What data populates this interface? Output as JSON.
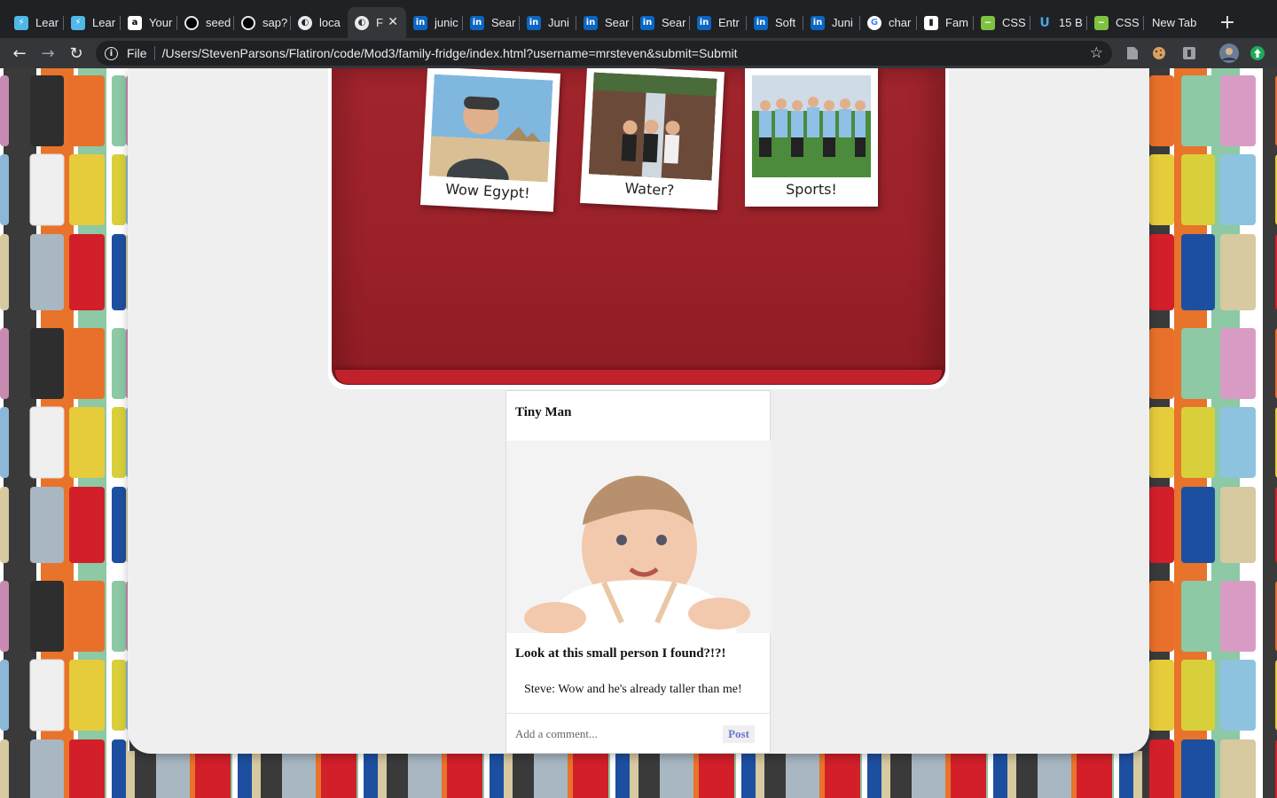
{
  "browser": {
    "tabs": [
      {
        "title": "Lear",
        "icon": "learn-icon",
        "color": "#4fb8e8"
      },
      {
        "title": "Lear",
        "icon": "learn-icon",
        "color": "#4fb8e8"
      },
      {
        "title": "Your",
        "icon": "amazon-icon",
        "color": "#ffffff"
      },
      {
        "title": "seed",
        "icon": "github-icon",
        "color": "#e8eaed"
      },
      {
        "title": "sap?",
        "icon": "github-icon",
        "color": "#e8eaed"
      },
      {
        "title": "loca",
        "icon": "globe-icon",
        "color": "#e8eaed"
      },
      {
        "title": "F",
        "icon": "globe-icon",
        "color": "#e8eaed",
        "active": true
      },
      {
        "title": "junic",
        "icon": "linkedin-icon",
        "color": "#0a66c2"
      },
      {
        "title": "Sear",
        "icon": "linkedin-icon",
        "color": "#0a66c2"
      },
      {
        "title": "Juni",
        "icon": "linkedin-icon",
        "color": "#0a66c2"
      },
      {
        "title": "Sear",
        "icon": "linkedin-icon",
        "color": "#0a66c2"
      },
      {
        "title": "Sear",
        "icon": "linkedin-icon",
        "color": "#0a66c2"
      },
      {
        "title": "Entr",
        "icon": "linkedin-icon",
        "color": "#0a66c2"
      },
      {
        "title": "Soft",
        "icon": "linkedin-icon",
        "color": "#0a66c2"
      },
      {
        "title": "Juni",
        "icon": "linkedin-icon",
        "color": "#0a66c2"
      },
      {
        "title": "char",
        "icon": "google-icon",
        "color": "#ffffff"
      },
      {
        "title": "Fam",
        "icon": "trello-icon",
        "color": "#ffffff"
      },
      {
        "title": "CSS",
        "icon": "css-icon",
        "color": "#7fc241"
      },
      {
        "title": "15 B",
        "icon": "u-icon",
        "color": "#4fa3e0"
      },
      {
        "title": "CSS",
        "icon": "css-icon",
        "color": "#7fc241"
      }
    ],
    "new_tab_label": "New Tab",
    "address": {
      "scheme_label": "File",
      "url": "/Users/StevenParsons/Flatiron/code/Mod3/family-fridge/index.html?username=mrsteven&submit=Submit"
    }
  },
  "fridge": {
    "photos": [
      {
        "caption": "Wow Egypt!"
      },
      {
        "caption": "Water?"
      },
      {
        "caption": "Sports!"
      }
    ]
  },
  "post": {
    "title": "Tiny Man",
    "caption": "Look at this small person I found?!?!",
    "comments": [
      {
        "text": "Steve: Wow and he's already taller than me!"
      }
    ],
    "comment_placeholder": "Add a comment...",
    "post_button_label": "Post"
  },
  "colors": {
    "fridge_red": "#9b2129",
    "post_button": "#6b73d6",
    "page_background": "#efefef"
  }
}
